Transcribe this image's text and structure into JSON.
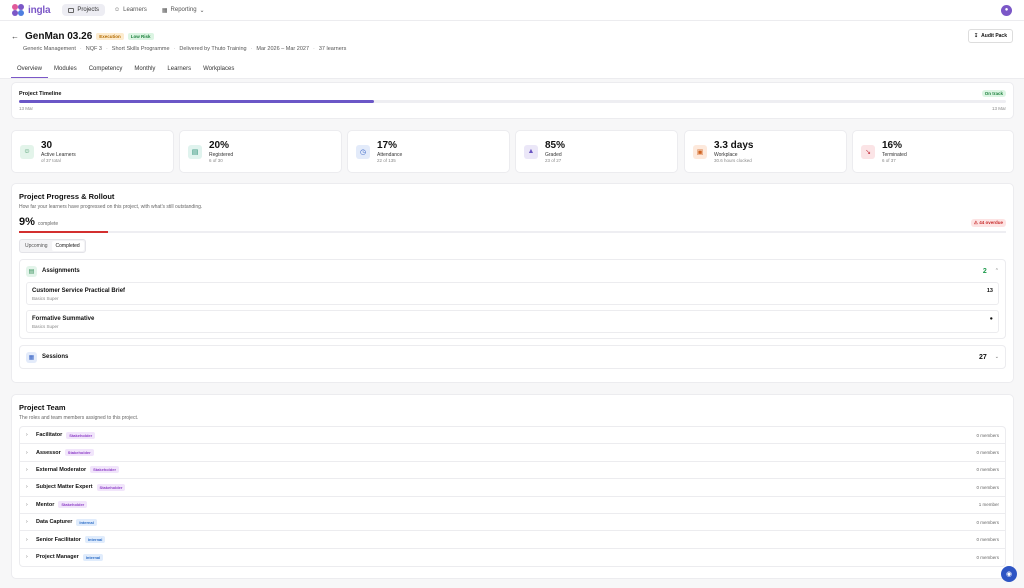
{
  "app": {
    "logo_text": "ingla",
    "user_initial": "●"
  },
  "nav": [
    {
      "label": "Projects",
      "icon": "folder-icon",
      "active": true
    },
    {
      "label": "Learners",
      "icon": "users-icon"
    },
    {
      "label": "Reporting",
      "icon": "chart-icon"
    }
  ],
  "project": {
    "title": "GenMan 03.26",
    "badge_stage": "Execution",
    "badge_risk": "Low Risk",
    "meta": [
      "Generic Management",
      "NQF 3",
      "Short Skills Programme",
      "Delivered by Thuto Training",
      "Mar 2026 – Mar 2027",
      "37 learners"
    ],
    "audit_label": "Audit Pack"
  },
  "tabs": [
    "Overview",
    "Modules",
    "Competency",
    "Monthly",
    "Learners",
    "Workplaces"
  ],
  "timeline": {
    "title": "Project Timeline",
    "status": "On track",
    "start": "13 Mar",
    "end": "13 Mar",
    "progress": 0.36
  },
  "stats": [
    {
      "value": "30",
      "label": "Active Learners",
      "sub": "of 37 total",
      "icon": "users-icon",
      "bg": "#e3f4ea",
      "fg": "#2e8a55"
    },
    {
      "value": "20%",
      "label": "Registered",
      "sub": "6 of 30",
      "icon": "clipboard-icon",
      "bg": "#e0f3ee",
      "fg": "#218b6f"
    },
    {
      "value": "17%",
      "label": "Attendance",
      "sub": "22 of 135",
      "icon": "clock-icon",
      "bg": "#e3ebfa",
      "fg": "#3360c4"
    },
    {
      "value": "85%",
      "label": "Graded",
      "sub": "23 of 27",
      "icon": "graduation-icon",
      "bg": "#ebe7f8",
      "fg": "#6a55c2"
    },
    {
      "value": "3.3 days",
      "label": "Workplace",
      "sub": "30.6 hours clocked",
      "icon": "briefcase-icon",
      "bg": "#fde9dc",
      "fg": "#d0621f"
    },
    {
      "value": "16%",
      "label": "Terminated",
      "sub": "6 of 37",
      "icon": "trend-down-icon",
      "bg": "#fbe4e6",
      "fg": "#c4323f"
    }
  ],
  "progress": {
    "title": "Project Progress & Rollout",
    "desc": "How far your learners have progressed on this project, with what's still outstanding.",
    "pct": "9%",
    "pct_label": "complete",
    "pct_value": 0.09,
    "overdue": "44 overdue",
    "segments": [
      "Upcoming",
      "Completed"
    ],
    "groups": [
      {
        "title": "Assignments",
        "count": "2",
        "count_color": "#1b9a4a",
        "icon": "clipboard-icon",
        "bg": "#e3f4ea",
        "fg": "#2e8a55",
        "items": [
          {
            "title": "Customer Service Practical Brief",
            "sub": "Basics Super",
            "num": "13"
          },
          {
            "title": "Formative Summative",
            "sub": "Basics Super",
            "num": "●"
          }
        ]
      },
      {
        "title": "Sessions",
        "count": "27",
        "count_color": "#111",
        "icon": "calendar-icon",
        "bg": "#e3ebfa",
        "fg": "#3360c4",
        "items": []
      }
    ]
  },
  "team": {
    "title": "Project Team",
    "desc": "The roles and team members assigned to this project.",
    "roles": [
      {
        "name": "Facilitator",
        "tag": "Stakeholder",
        "type": "stake",
        "count": "0 members"
      },
      {
        "name": "Assessor",
        "tag": "Stakeholder",
        "type": "stake",
        "count": "0 members"
      },
      {
        "name": "External Moderator",
        "tag": "Stakeholder",
        "type": "stake",
        "count": "0 members"
      },
      {
        "name": "Subject Matter Expert",
        "tag": "Stakeholder",
        "type": "stake",
        "count": "0 members"
      },
      {
        "name": "Mentor",
        "tag": "Stakeholder",
        "type": "stake",
        "count": "1 member"
      },
      {
        "name": "Data Capturer",
        "tag": "Internal",
        "type": "int",
        "count": "0 members"
      },
      {
        "name": "Senior Facilitator",
        "tag": "Internal",
        "type": "int",
        "count": "0 members"
      },
      {
        "name": "Project Manager",
        "tag": "Internal",
        "type": "int",
        "count": "0 members"
      }
    ]
  }
}
